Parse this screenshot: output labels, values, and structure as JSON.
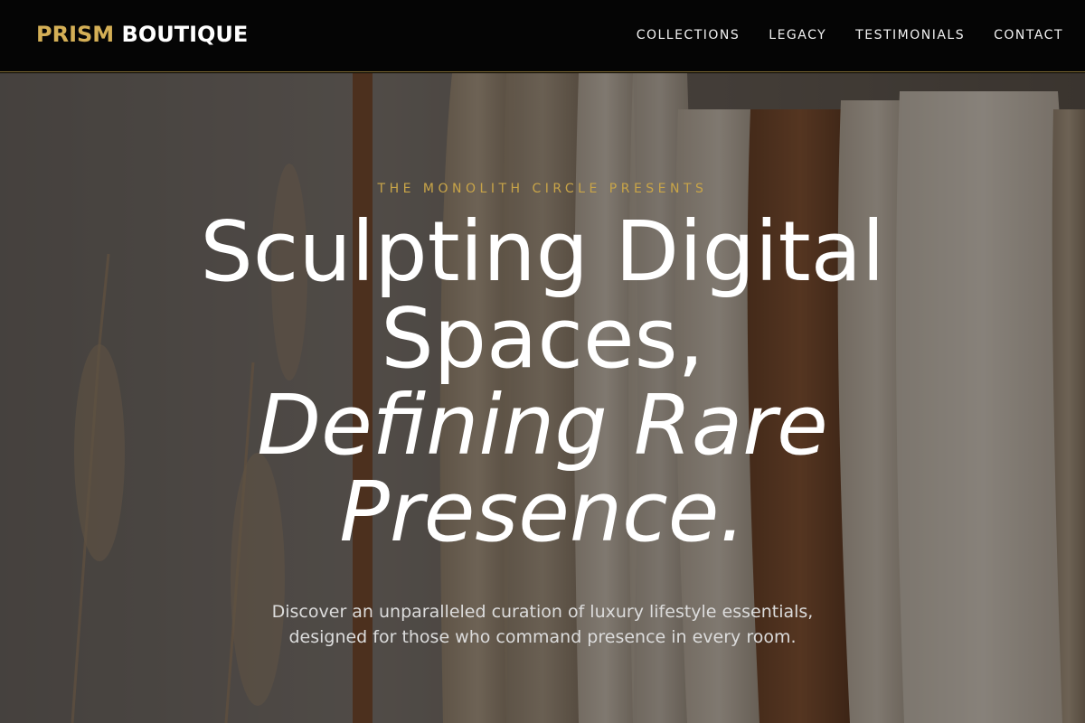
{
  "brand": {
    "accent": "PRISM",
    "main": "BOUTIQUE"
  },
  "nav": {
    "items": [
      {
        "label": "COLLECTIONS"
      },
      {
        "label": "LEGACY"
      },
      {
        "label": "TESTIMONIALS"
      },
      {
        "label": "CONTACT"
      }
    ]
  },
  "hero": {
    "eyebrow": "THE MONOLITH CIRCLE PRESENTS",
    "headline_line1": "Sculpting Digital",
    "headline_line2": "Spaces,",
    "headline_line3": "Defining Rare",
    "headline_line4": "Presence.",
    "subcopy_line1": "Discover an unparalleled curation of luxury lifestyle essentials,",
    "subcopy_line2": "designed for those who command presence in every room."
  },
  "colors": {
    "accent": "#d4af56",
    "nav_bg": "#050505",
    "text": "#ffffff"
  },
  "icons": {
    "hero_image": "clothing-rack-photo"
  }
}
